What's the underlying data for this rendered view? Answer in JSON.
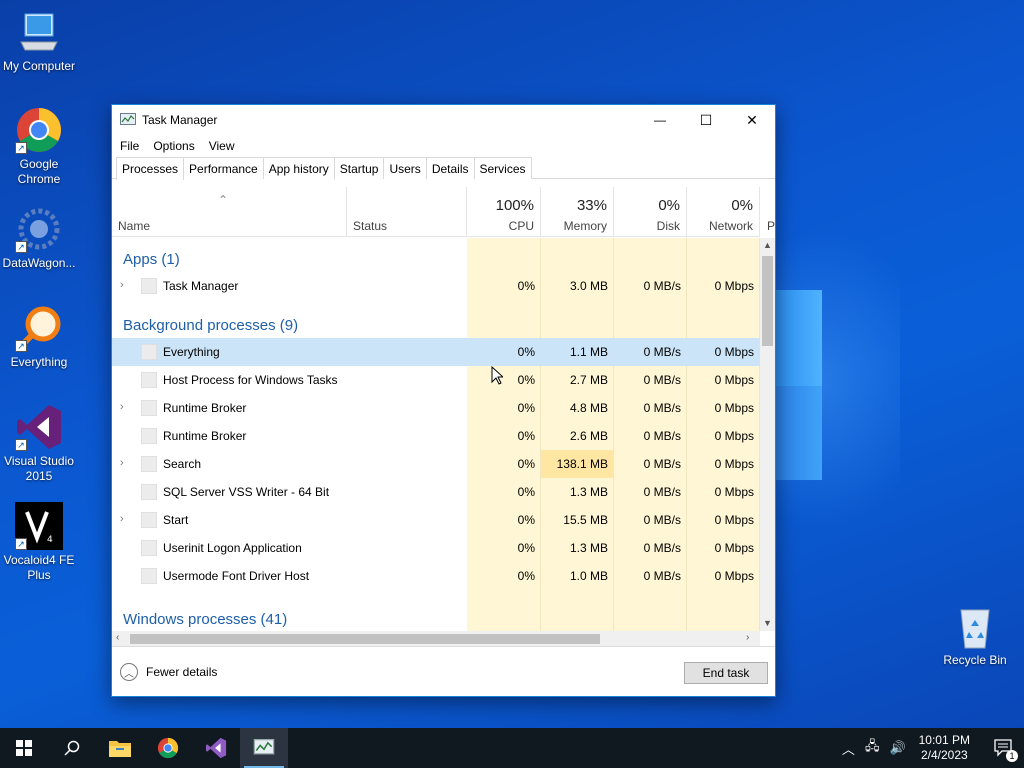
{
  "desktop": {
    "icons": [
      {
        "label": "My Computer",
        "icon": "computer-icon"
      },
      {
        "label": "Google Chrome",
        "icon": "chrome-icon"
      },
      {
        "label": "DataWagon...",
        "icon": "datawagon-icon"
      },
      {
        "label": "Everything",
        "icon": "everything-icon"
      },
      {
        "label": "Visual Studio 2015",
        "icon": "visual-studio-icon"
      },
      {
        "label": "Vocaloid4 FE Plus",
        "icon": "vocaloid-icon"
      },
      {
        "label": "Recycle Bin",
        "icon": "recycle-bin-icon"
      }
    ]
  },
  "window": {
    "title": "Task Manager",
    "controls": {
      "minimize": "—",
      "maximize": "☐",
      "close": "✕"
    },
    "menu": [
      "File",
      "Options",
      "View"
    ],
    "tabs": [
      "Processes",
      "Performance",
      "App history",
      "Startup",
      "Users",
      "Details",
      "Services"
    ],
    "active_tab": "Processes"
  },
  "columns": {
    "name": "Name",
    "status": "Status",
    "cpu": {
      "pct": "100%",
      "label": "CPU"
    },
    "memory": {
      "pct": "33%",
      "label": "Memory"
    },
    "disk": {
      "pct": "0%",
      "label": "Disk"
    },
    "network": {
      "pct": "0%",
      "label": "Network"
    },
    "power": "P"
  },
  "groups": {
    "apps": "Apps (1)",
    "background": "Background processes (9)",
    "windows": "Windows processes (41)"
  },
  "processes": {
    "apps": [
      {
        "name": "Task Manager",
        "expandable": true,
        "cpu": "0%",
        "memory": "3.0 MB",
        "disk": "0 MB/s",
        "network": "0 Mbps"
      }
    ],
    "background": [
      {
        "name": "Everything",
        "expandable": false,
        "cpu": "0%",
        "memory": "1.1 MB",
        "disk": "0 MB/s",
        "network": "0 Mbps"
      },
      {
        "name": "Host Process for Windows Tasks",
        "expandable": false,
        "cpu": "0%",
        "memory": "2.7 MB",
        "disk": "0 MB/s",
        "network": "0 Mbps"
      },
      {
        "name": "Runtime Broker",
        "expandable": true,
        "cpu": "0%",
        "memory": "4.8 MB",
        "disk": "0 MB/s",
        "network": "0 Mbps"
      },
      {
        "name": "Runtime Broker",
        "expandable": false,
        "cpu": "0%",
        "memory": "2.6 MB",
        "disk": "0 MB/s",
        "network": "0 Mbps"
      },
      {
        "name": "Search",
        "expandable": true,
        "cpu": "0%",
        "memory": "138.1 MB",
        "disk": "0 MB/s",
        "network": "0 Mbps"
      },
      {
        "name": "SQL Server VSS Writer - 64 Bit",
        "expandable": false,
        "cpu": "0%",
        "memory": "1.3 MB",
        "disk": "0 MB/s",
        "network": "0 Mbps"
      },
      {
        "name": "Start",
        "expandable": true,
        "cpu": "0%",
        "memory": "15.5 MB",
        "disk": "0 MB/s",
        "network": "0 Mbps"
      },
      {
        "name": "Userinit Logon Application",
        "expandable": false,
        "cpu": "0%",
        "memory": "1.3 MB",
        "disk": "0 MB/s",
        "network": "0 Mbps"
      },
      {
        "name": "Usermode Font Driver Host",
        "expandable": false,
        "cpu": "0%",
        "memory": "1.0 MB",
        "disk": "0 MB/s",
        "network": "0 Mbps"
      }
    ]
  },
  "footer": {
    "fewer_details": "Fewer details",
    "end_task": "End task"
  },
  "taskbar": {
    "items": [
      "start-icon",
      "search-icon",
      "file-explorer-icon",
      "chrome-icon",
      "visual-studio-icon",
      "task-manager-icon"
    ],
    "time": "10:01 PM",
    "date": "2/4/2023",
    "notification_count": "1"
  },
  "colors": {
    "accent": "#1883d7",
    "heat_light": "#fff6d5",
    "heat_strong": "#ffe6a3",
    "selection": "#cce4f7",
    "group_title": "#1e5fa8"
  }
}
